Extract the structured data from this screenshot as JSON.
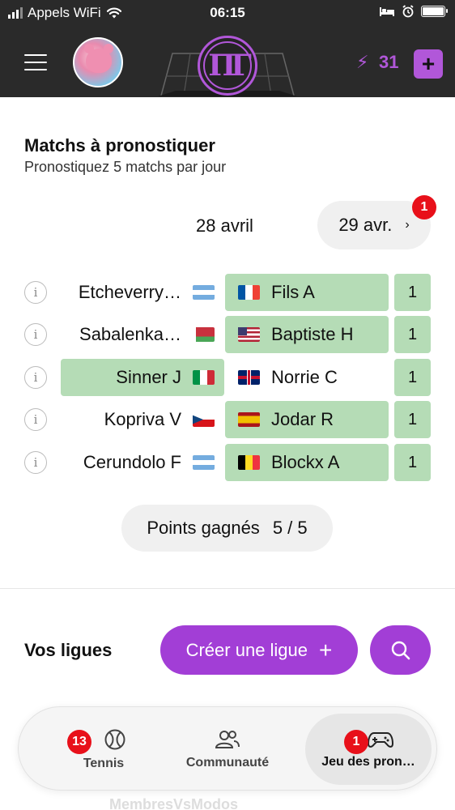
{
  "status_bar": {
    "carrier": "Appels WiFi",
    "time": "06:15"
  },
  "header": {
    "energy_count": "31",
    "icons": [
      "menu-icon",
      "avatar",
      "app-logo",
      "bolt-icon",
      "plus-icon"
    ]
  },
  "matches": {
    "title": "Matchs à pronostiquer",
    "subtitle": "Pronostiquez 5 matchs par jour",
    "current_date": "28 avril",
    "next_date": "29 avr.",
    "next_date_badge": "1",
    "rows": [
      {
        "left": "Etcheverry…",
        "left_flag": "AR",
        "right": "Fils A",
        "right_flag": "FR",
        "pick": "right",
        "score": "1"
      },
      {
        "left": "Sabalenka…",
        "left_flag": "BY",
        "right": "Baptiste H",
        "right_flag": "US",
        "pick": "right",
        "score": "1"
      },
      {
        "left": "Sinner J",
        "left_flag": "IT",
        "right": "Norrie C",
        "right_flag": "GB",
        "pick": "left",
        "score": "1"
      },
      {
        "left": "Kopriva V",
        "left_flag": "CZ",
        "right": "Jodar R",
        "right_flag": "ES",
        "pick": "right",
        "score": "1"
      },
      {
        "left": "Cerundolo F",
        "left_flag": "AR",
        "right": "Blockx A",
        "right_flag": "BE",
        "pick": "right",
        "score": "1"
      }
    ],
    "points_label": "Points gagnés",
    "points_value": "5 / 5"
  },
  "leagues": {
    "title": "Vos ligues",
    "create_label": "Créer une ligue",
    "partial_text": "MembresVsModos"
  },
  "bottom_nav": {
    "items": [
      {
        "label": "Tennis",
        "badge": "13",
        "icon": "tennis-ball-icon"
      },
      {
        "label": "Communauté",
        "icon": "users-icon"
      },
      {
        "label": "Jeu des pron…",
        "badge": "1",
        "icon": "gamepad-icon"
      }
    ]
  },
  "colors": {
    "accent": "#a23ed6",
    "header_bg": "#2a2a2a",
    "selected_green": "#b5dcb6",
    "badge_red": "#e8101a"
  }
}
